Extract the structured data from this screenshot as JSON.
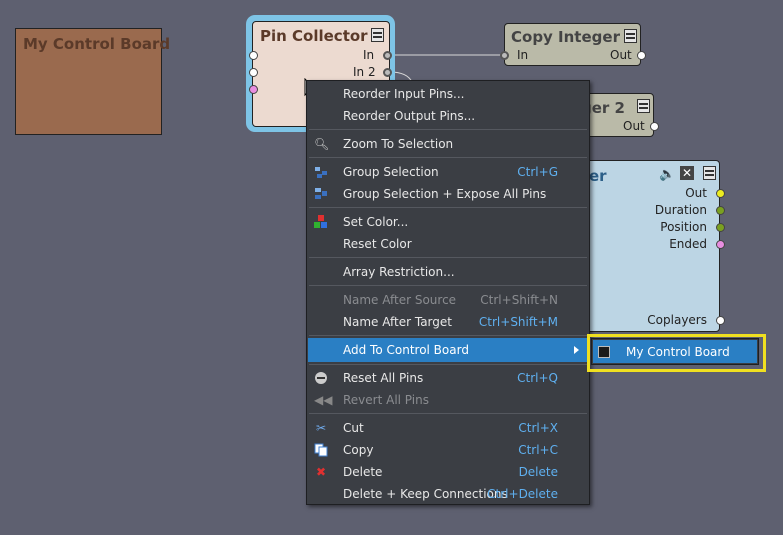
{
  "control_board_node": {
    "title": "My Control Board"
  },
  "pin_collector": {
    "title": "Pin Collector",
    "pin_in": "In",
    "pin_in2": "In 2"
  },
  "copy_integer": {
    "title": "Copy Integer",
    "pin_in": "In",
    "pin_out": "Out"
  },
  "copy_integer2": {
    "title": "Copy Integer 2",
    "title_visible": "ger 2",
    "pin_out": "Out"
  },
  "media_node": {
    "title_visible": "er",
    "pins": [
      "Out",
      "Duration",
      "Position",
      "Ended"
    ],
    "coplayers": "Coplayers"
  },
  "context_menu": {
    "items": [
      {
        "label": "Reorder Input Pins...",
        "shortcut": ""
      },
      {
        "label": "Reorder Output Pins...",
        "shortcut": ""
      },
      {
        "label": "Zoom To Selection",
        "shortcut": "",
        "icon": "magnifier-icon"
      },
      {
        "label": "Group Selection",
        "shortcut": "Ctrl+G",
        "icon": "group-icon"
      },
      {
        "label": "Group Selection + Expose All Pins",
        "shortcut": "",
        "icon": "group-expose-icon"
      },
      {
        "label": "Set Color...",
        "shortcut": "",
        "icon": "color-icon"
      },
      {
        "label": "Reset Color",
        "shortcut": ""
      },
      {
        "label": "Array Restriction...",
        "shortcut": ""
      },
      {
        "label": "Name After Source",
        "shortcut": "Ctrl+Shift+N",
        "disabled": true
      },
      {
        "label": "Name After Target",
        "shortcut": "Ctrl+Shift+M"
      },
      {
        "label": "Add To Control Board",
        "shortcut": "",
        "active": true,
        "submenu": true
      },
      {
        "label": "Reset All Pins",
        "shortcut": "Ctrl+Q",
        "icon": "reset-icon"
      },
      {
        "label": "Revert All Pins",
        "shortcut": "",
        "disabled": true,
        "icon": "revert-icon"
      },
      {
        "label": "Cut",
        "shortcut": "Ctrl+X",
        "icon": "scissors-icon"
      },
      {
        "label": "Copy",
        "shortcut": "Ctrl+C",
        "icon": "copy-icon"
      },
      {
        "label": "Delete",
        "shortcut": "Delete",
        "icon": "delete-icon"
      },
      {
        "label": "Delete + Keep Connections",
        "shortcut": "Ctrl+Delete"
      }
    ]
  },
  "submenu": {
    "items": [
      {
        "label": "My Control Board"
      }
    ]
  },
  "colors": {
    "highlight": "#2a7fc4",
    "shortcut": "#5fb0f0",
    "callout": "#f0e020"
  }
}
